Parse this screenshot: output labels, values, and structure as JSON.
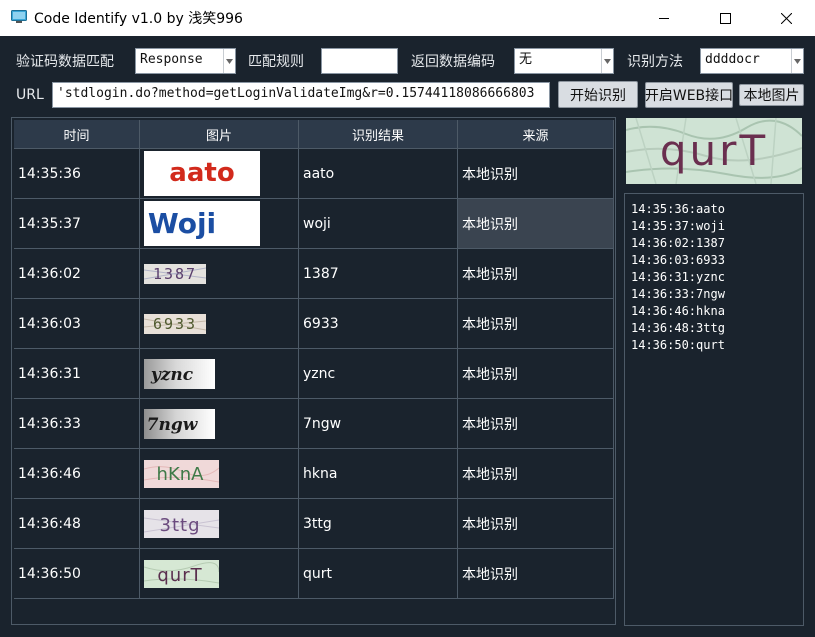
{
  "window": {
    "title": "Code Identify v1.0 by 浅笑996",
    "controls": {
      "minimize": "—",
      "maximize": "☐",
      "close": "✕"
    }
  },
  "toolbar": {
    "captcha_match_label": "验证码数据匹配",
    "captcha_match_value": "Response",
    "match_rule_label": "匹配规则",
    "match_rule_value": "",
    "return_encoding_label": "返回数据编码",
    "return_encoding_value": "无",
    "method_label": "识别方法",
    "method_value": "ddddocr",
    "url_label": "URL",
    "url_value": "'stdlogin.do?method=getLoginValidateImg&r=0.15744118086666803",
    "start_button": "开始识别",
    "web_button": "开启WEB接口",
    "local_button": "本地图片"
  },
  "table": {
    "headers": [
      "时间",
      "图片",
      "识别结果",
      "来源"
    ],
    "rows": [
      {
        "time": "14:35:36",
        "image_text": "aato",
        "result": "aato",
        "source": "本地识别"
      },
      {
        "time": "14:35:37",
        "image_text": "Woji",
        "result": "woji",
        "source": "本地识别"
      },
      {
        "time": "14:36:02",
        "image_text": "1387",
        "result": "1387",
        "source": "本地识别"
      },
      {
        "time": "14:36:03",
        "image_text": "6933",
        "result": "6933",
        "source": "本地识别"
      },
      {
        "time": "14:36:31",
        "image_text": "yznc",
        "result": "yznc",
        "source": "本地识别"
      },
      {
        "time": "14:36:33",
        "image_text": "7ngw",
        "result": "7ngw",
        "source": "本地识别"
      },
      {
        "time": "14:36:46",
        "image_text": "hKnA",
        "result": "hkna",
        "source": "本地识别"
      },
      {
        "time": "14:36:48",
        "image_text": "3ttg",
        "result": "3ttg",
        "source": "本地识别"
      },
      {
        "time": "14:36:50",
        "image_text": "qurT",
        "result": "qurt",
        "source": "本地识别"
      }
    ],
    "highlighted_row": 1
  },
  "preview": {
    "image_text": "qurT"
  },
  "log": {
    "lines": [
      "14:35:36:aato",
      "14:35:37:woji",
      "14:36:02:1387",
      "14:36:03:6933",
      "14:36:31:yznc",
      "14:36:33:7ngw",
      "14:36:46:hkna",
      "14:36:48:3ttg",
      "14:36:50:qurt"
    ]
  },
  "colors": {
    "background": "#1a232d",
    "header_bg": "#2d3a4a",
    "highlight": "#3a4450",
    "border": "#4d5a67",
    "text": "#ffffff"
  }
}
